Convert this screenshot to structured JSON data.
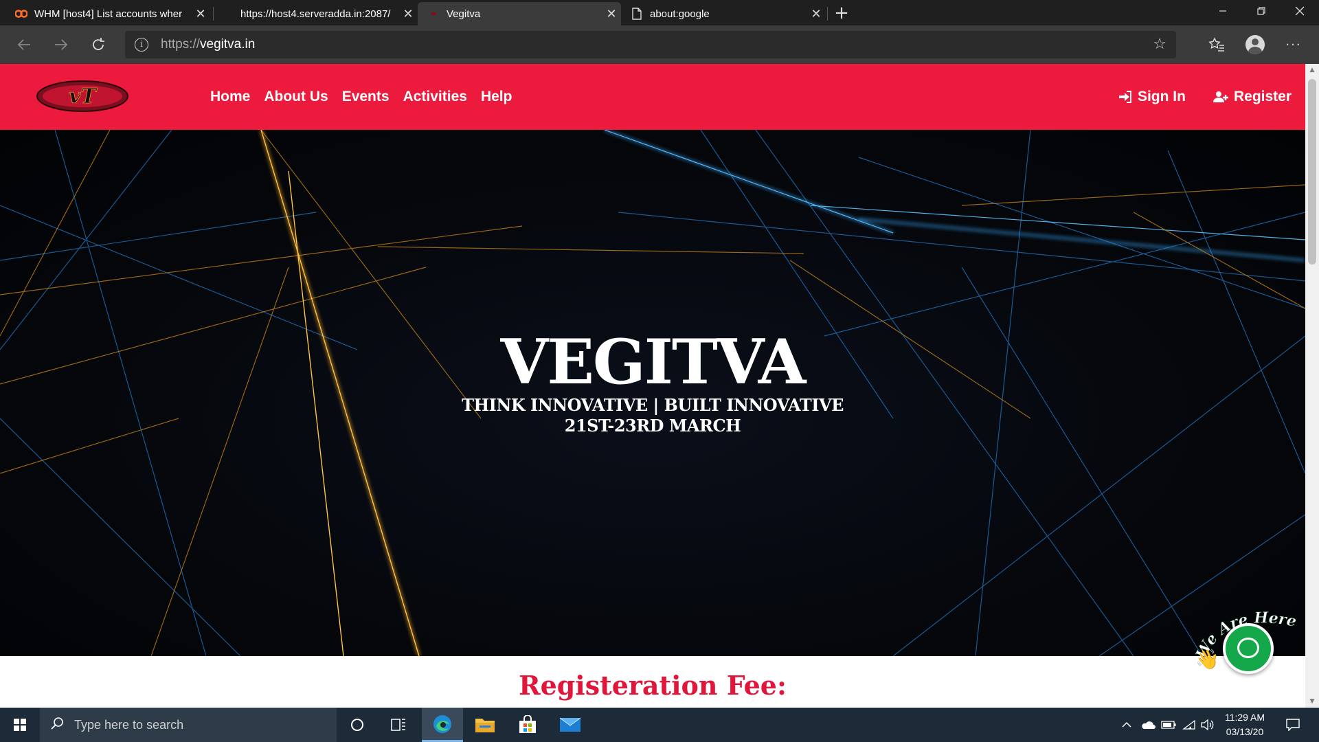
{
  "browser": {
    "tabs": [
      {
        "label": "WHM [host4] List accounts wher",
        "icon": "cpanel-icon",
        "active": false
      },
      {
        "label": "https://host4.serveradda.in:2087/",
        "icon": "blank-icon",
        "active": false
      },
      {
        "label": "Vegitva",
        "icon": "vegitva-favicon",
        "active": true
      },
      {
        "label": "about:google",
        "icon": "page-icon",
        "active": false
      }
    ],
    "url_scheme": "https://",
    "url_host": "vegitva.in"
  },
  "site": {
    "nav": {
      "links": [
        "Home",
        "About Us",
        "Events",
        "Activities",
        "Help"
      ],
      "sign_in": "Sign In",
      "register": "Register"
    },
    "hero": {
      "title": "VEGITVA",
      "tagline": "THINK INNOVATIVE | BUILT INNOVATIVE",
      "dates": "21ST-23RD MARCH"
    },
    "fee_heading": "Registeration Fee:",
    "chat_widget": {
      "caption": "We Are Here!"
    }
  },
  "colors": {
    "nav_bg": "#ec1a3c",
    "fee_heading": "#e0173a",
    "chat_green": "#14a84a"
  },
  "taskbar": {
    "search_placeholder": "Type here to search",
    "time": "11:29 AM",
    "date": "03/13/20"
  }
}
